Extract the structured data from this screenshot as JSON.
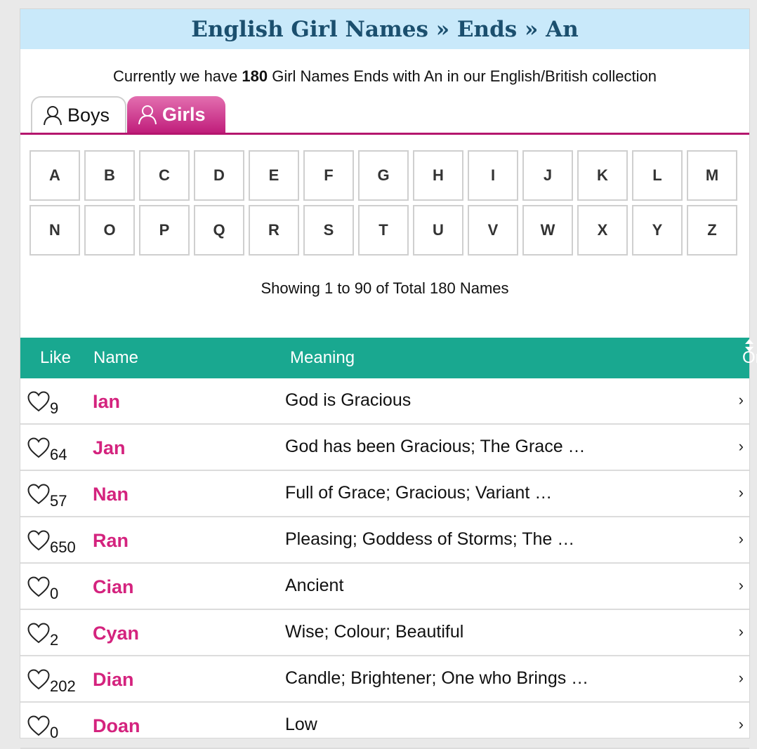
{
  "header": {
    "title": "English Girl Names » Ends » An"
  },
  "summary": {
    "prefix": "Currently we have ",
    "count": "180",
    "suffix": " Girl Names Ends with An in our English/British collection"
  },
  "tabs": [
    {
      "label": "Boys",
      "icon": "person-outline-icon"
    },
    {
      "label": "Girls",
      "icon": "person-outline-icon",
      "active": true
    }
  ],
  "letters": [
    "A",
    "B",
    "C",
    "D",
    "E",
    "F",
    "G",
    "H",
    "I",
    "J",
    "K",
    "L",
    "M",
    "N",
    "O",
    "P",
    "Q",
    "R",
    "S",
    "T",
    "U",
    "V",
    "W",
    "X",
    "Y",
    "Z"
  ],
  "showing": "Showing 1 to 90 of Total 180 Names",
  "table": {
    "columns": {
      "like": "Like",
      "name": "Name",
      "meaning": "Meaning",
      "order": "Order"
    },
    "rows": [
      {
        "likes": "9",
        "name": "Ian",
        "meaning": "God is Gracious"
      },
      {
        "likes": "64",
        "name": "Jan",
        "meaning": "God has been Gracious; The Grace …"
      },
      {
        "likes": "57",
        "name": "Nan",
        "meaning": "Full of Grace; Gracious; Variant …"
      },
      {
        "likes": "650",
        "name": "Ran",
        "meaning": "Pleasing; Goddess of Storms; The …"
      },
      {
        "likes": "0",
        "name": "Cian",
        "meaning": "Ancient"
      },
      {
        "likes": "2",
        "name": "Cyan",
        "meaning": "Wise; Colour; Beautiful"
      },
      {
        "likes": "202",
        "name": "Dian",
        "meaning": "Candle; Brightener; One who Brings …"
      },
      {
        "likes": "0",
        "name": "Doan",
        "meaning": "Low"
      }
    ]
  },
  "colors": {
    "accent_pink": "#d4237e",
    "table_header": "#19a890",
    "title_bg": "#c9e9fa",
    "title_text": "#1b4f6e"
  }
}
